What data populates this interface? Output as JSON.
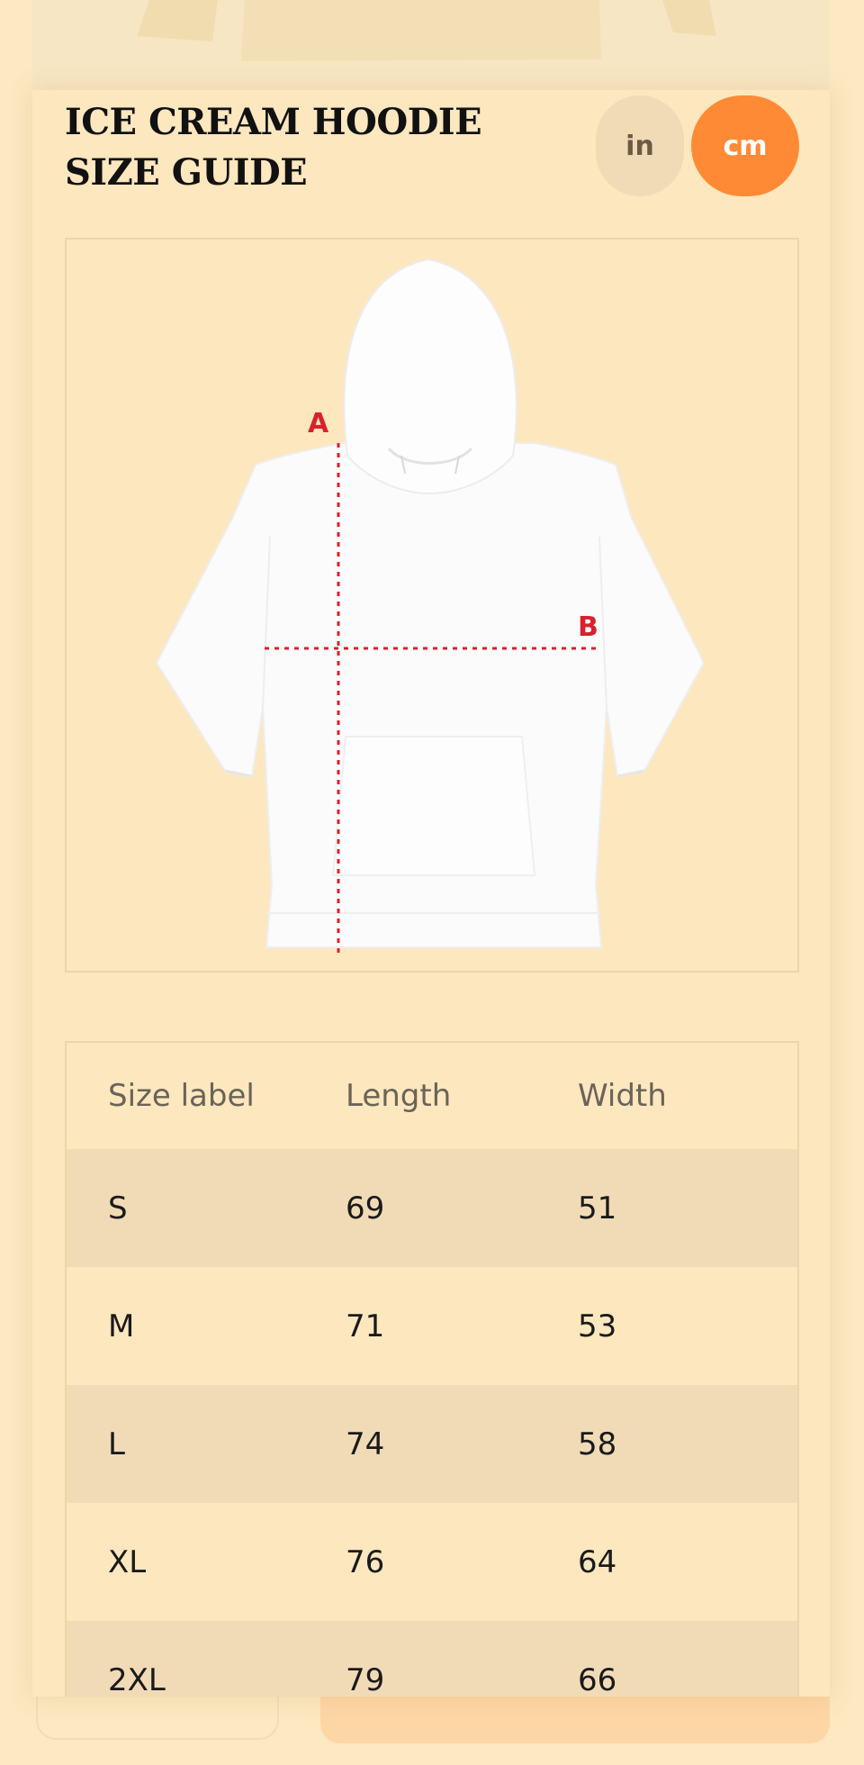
{
  "modal": {
    "title": "ICE CREAM HOODIE SIZE GUIDE",
    "units": [
      {
        "label": "in",
        "active": false
      },
      {
        "label": "cm",
        "active": true
      }
    ]
  },
  "diagram": {
    "label_a": "A",
    "label_b": "B"
  },
  "table": {
    "headers": [
      "Size label",
      "Length",
      "Width"
    ],
    "rows": [
      [
        "S",
        "69",
        "51"
      ],
      [
        "M",
        "71",
        "53"
      ],
      [
        "L",
        "74",
        "58"
      ],
      [
        "XL",
        "76",
        "64"
      ],
      [
        "2XL",
        "79",
        "66"
      ]
    ]
  },
  "colors": {
    "background": "#fce8c1",
    "accent": "#fe8a35",
    "row_shade": "#f1dbb6",
    "measure_line": "#d9202e"
  }
}
